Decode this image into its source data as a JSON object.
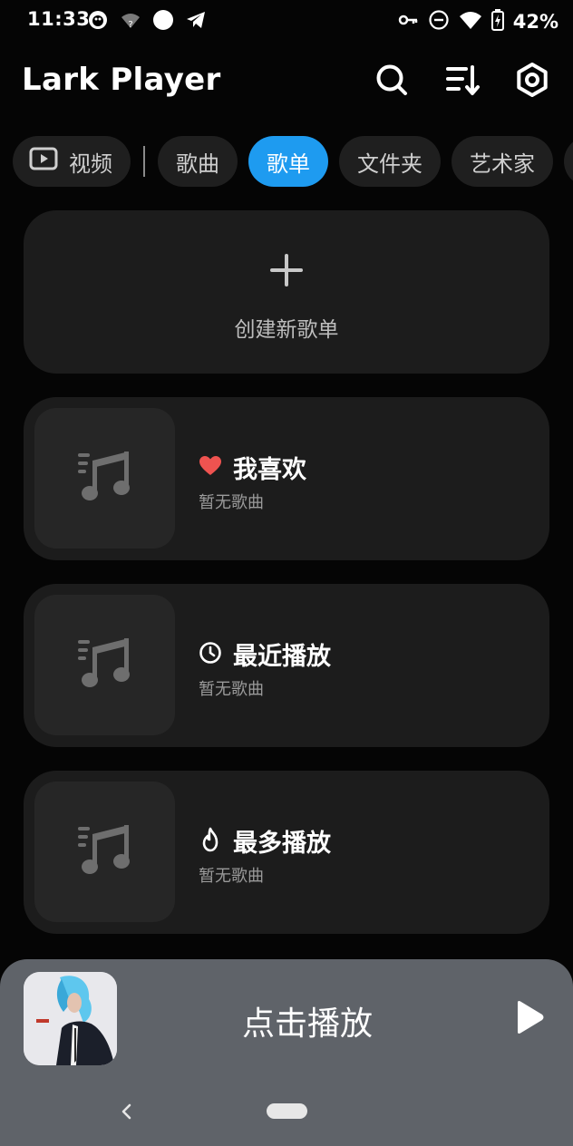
{
  "status_bar": {
    "time": "11:33",
    "battery_percent": "42%",
    "left_icons": [
      "penguin-app-icon",
      "wifi-unknown-icon",
      "circle-dot-icon",
      "telegram-icon"
    ],
    "right_icons": [
      "vpn-key-icon",
      "do-not-disturb-icon",
      "wifi-icon",
      "battery-charging-icon"
    ]
  },
  "header": {
    "title": "Lark Player",
    "actions": [
      "search-icon",
      "sort-icon",
      "settings-icon"
    ]
  },
  "tabs": [
    {
      "label": "视频",
      "active": false
    },
    {
      "label": "歌曲",
      "active": false
    },
    {
      "label": "歌单",
      "active": true
    },
    {
      "label": "文件夹",
      "active": false
    },
    {
      "label": "艺术家",
      "active": false
    }
  ],
  "create_playlist": {
    "label": "创建新歌单"
  },
  "playlists": [
    {
      "title": "我喜欢",
      "subtitle": "暂无歌曲",
      "icon": "heart-icon"
    },
    {
      "title": "最近播放",
      "subtitle": "暂无歌曲",
      "icon": "clock-icon"
    },
    {
      "title": "最多播放",
      "subtitle": "暂无歌曲",
      "icon": "flame-icon"
    }
  ],
  "mini_player": {
    "label": "点击播放"
  },
  "colors": {
    "accent": "#1e9bf0",
    "card": "#1c1c1c",
    "heart": "#ef5350",
    "mini_player_bg": "#5f6369"
  }
}
